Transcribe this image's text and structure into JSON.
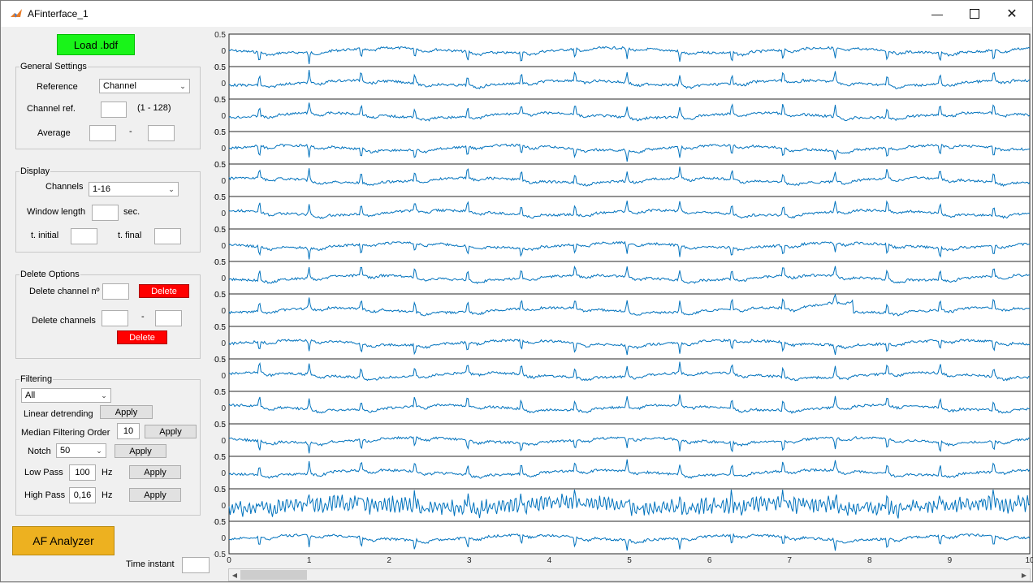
{
  "window": {
    "title": "AFinterface_1",
    "minimize_icon": "minimize-icon",
    "maximize_icon": "maximize-icon",
    "close_icon": "close-icon"
  },
  "load_button": "Load .bdf",
  "general": {
    "title": "General Settings",
    "reference_label": "Reference",
    "reference_value": "Channel",
    "channel_ref_label": "Channel ref.",
    "channel_ref_value": "",
    "channel_ref_range": "(1 - 128)",
    "average_label": "Average",
    "average_from": "",
    "average_dash": "-",
    "average_to": ""
  },
  "display": {
    "title": "Display",
    "channels_label": "Channels",
    "channels_value": "1-16",
    "window_length_label": "Window length",
    "window_length_value": "",
    "window_length_unit": "sec.",
    "t_initial_label": "t. initial",
    "t_initial_value": "",
    "t_final_label": "t. final",
    "t_final_value": ""
  },
  "delete": {
    "title": "Delete Options",
    "delete_channel_label": "Delete channel nº",
    "delete_channel_value": "",
    "delete_button": "Delete",
    "delete_channels_label": "Delete channels",
    "from_value": "",
    "dash": "-",
    "to_value": "",
    "delete_button2": "Delete"
  },
  "filtering": {
    "title": "Filtering",
    "select_value": "All",
    "linear_label": "Linear detrending",
    "apply": "Apply",
    "median_label": "Median Filtering Order",
    "median_value": "10",
    "notch_label": "Notch",
    "notch_value": "50",
    "lowpass_label": "Low Pass",
    "lowpass_value": "100",
    "highpass_label": "High Pass",
    "highpass_value": "0,16",
    "hz": "Hz"
  },
  "af_button": "AF Analyzer",
  "time_instant_label": "Time instant",
  "time_instant_value": "",
  "chart_data": {
    "type": "line",
    "title": "",
    "channels": 16,
    "subplot_yticks": [
      "0.5",
      "0",
      "-0.5"
    ],
    "ylim": [
      -0.5,
      0.5
    ],
    "xlim": [
      0,
      10
    ],
    "xticks": [
      "0",
      "1",
      "2",
      "3",
      "4",
      "5",
      "6",
      "7",
      "8",
      "9",
      "10"
    ],
    "line_color": "#0072bd",
    "r_peak_times_s": [
      0.38,
      1.0,
      1.65,
      2.32,
      2.98,
      3.65,
      4.32,
      4.97,
      5.63,
      6.28,
      6.92,
      7.57,
      8.22,
      8.88,
      9.55
    ]
  }
}
